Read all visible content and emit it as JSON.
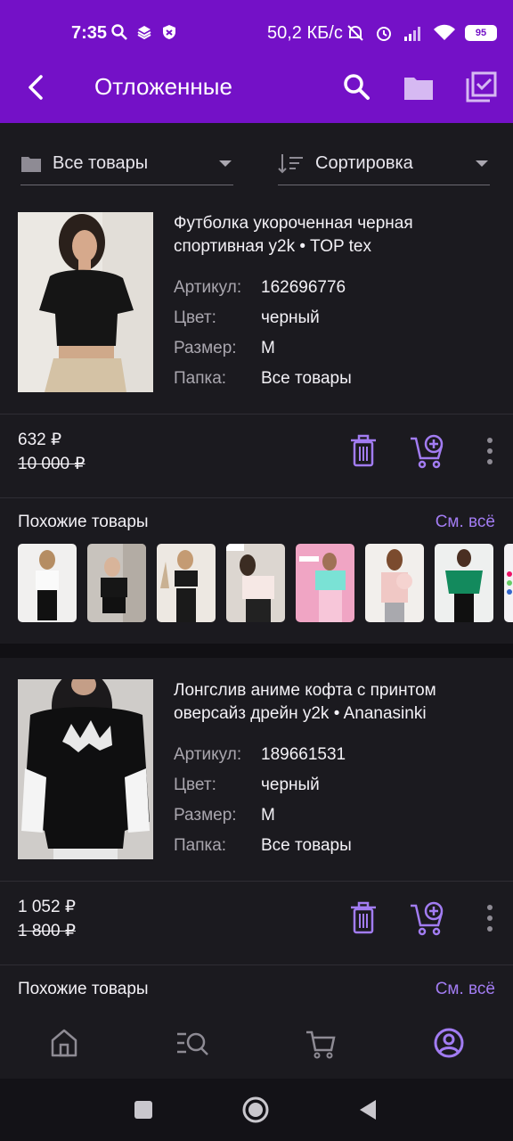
{
  "status_bar": {
    "time": "7:35",
    "speed": "50,2 КБ/с",
    "battery": "95"
  },
  "header": {
    "title": "Отложенные"
  },
  "filters": {
    "folder": "Все товары",
    "sort": "Сортировка"
  },
  "labels": {
    "article": "Артикул:",
    "color": "Цвет:",
    "size": "Размер:",
    "folder": "Папка:",
    "similar": "Похожие товары",
    "see_all": "См. всё"
  },
  "products": [
    {
      "title": "Футболка укороченная черная спортивная y2k • TOP tex",
      "article": "162696776",
      "color": "черный",
      "size": "M",
      "folder": "Все товары",
      "price": "632 ₽",
      "old_price": "10 000 ₽"
    },
    {
      "title": "Лонгслив аниме кофта с принтом оверсайз дрейн y2k • Ananasinki",
      "article": "189661531",
      "color": "черный",
      "size": "M",
      "folder": "Все товары",
      "price": "1 052 ₽",
      "old_price": "1 800 ₽"
    }
  ],
  "icons": {
    "back": "back-arrow-icon",
    "search": "search-icon",
    "folder": "folder-icon",
    "select": "select-checkbox-icon",
    "delete": "trash-icon",
    "add_to_cart": "cart-add-icon",
    "more": "more-vertical-icon",
    "home": "home-icon",
    "catalog": "catalog-search-icon",
    "cart": "cart-icon",
    "profile": "profile-icon"
  },
  "colors": {
    "header": "#7411c7",
    "accent": "#a27cf2",
    "background": "#1b1a1f"
  }
}
